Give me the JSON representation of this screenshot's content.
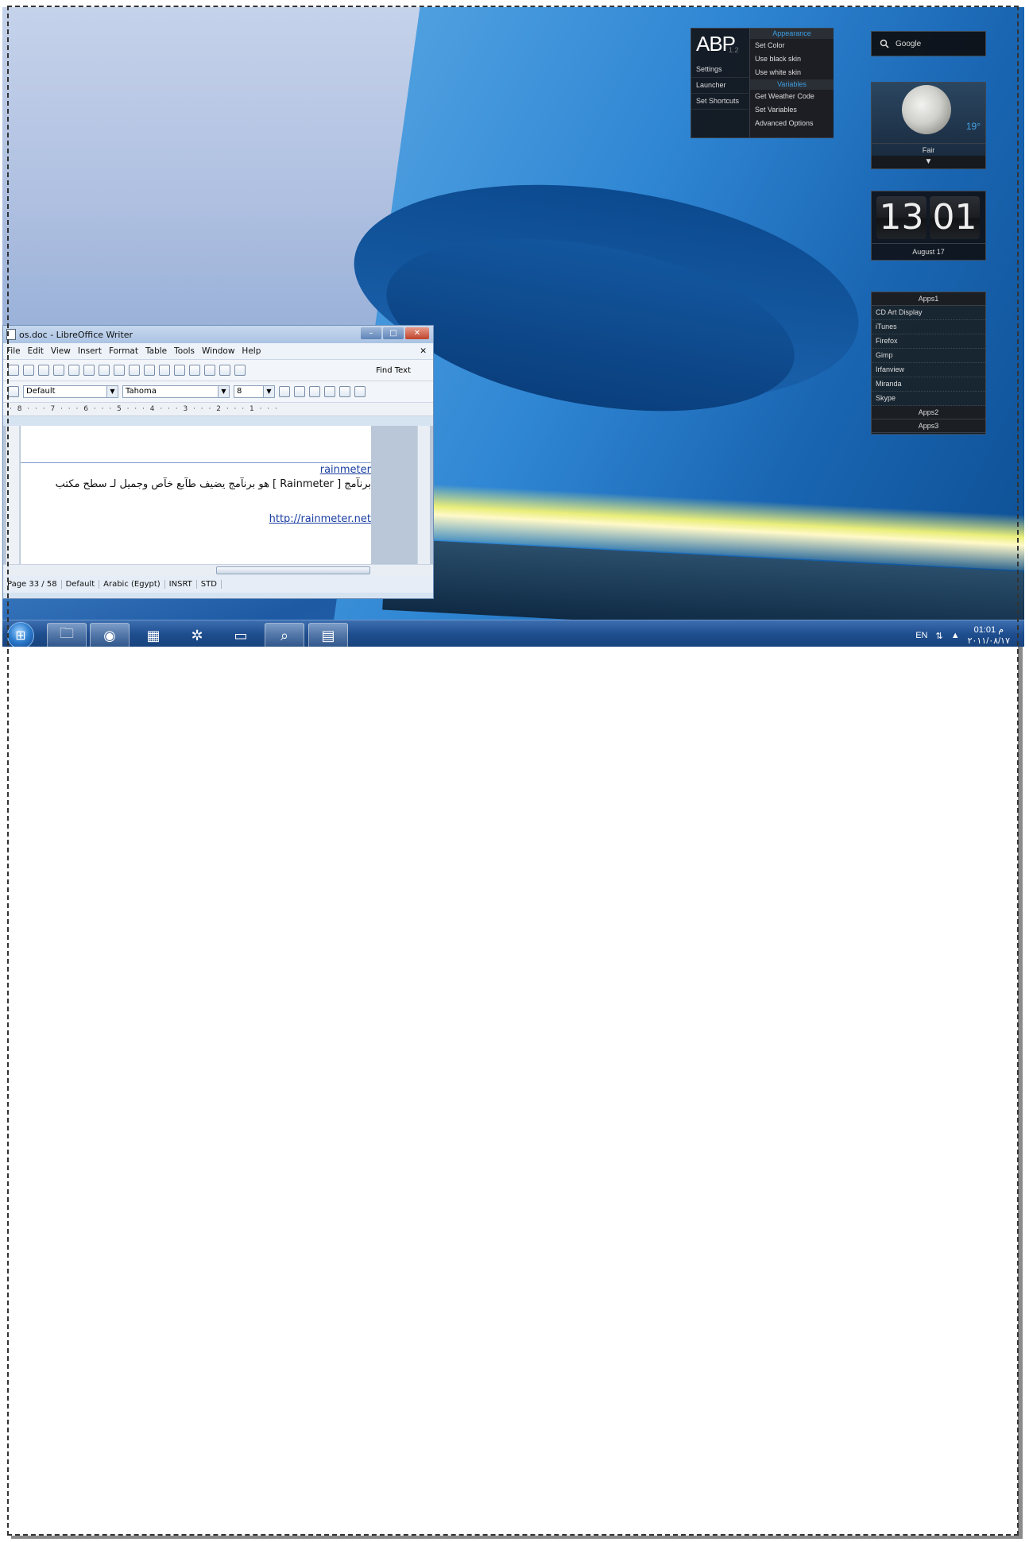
{
  "writer": {
    "title": "os.doc - LibreOffice Writer",
    "menu": [
      "File",
      "Edit",
      "View",
      "Insert",
      "Format",
      "Table",
      "Tools",
      "Window",
      "Help"
    ],
    "find_text": "Find Text",
    "style_value": "Default",
    "font_value": "Tahoma",
    "size_value": "8",
    "ruler_text": "· 8 · · · 7 · · · 6 · · · 5 · · · 4 · · · 3 · · · 2 · · · 1 · · ·",
    "doc_heading": "rainmeter",
    "doc_paragraph": "برنآمج [ Rainmeter ] هو برنآمج يضيف طآبع خآص وجميل لـ سطح مكتب",
    "doc_link": "http://rainmeter.net",
    "status": {
      "page": "Page 33 / 58",
      "style": "Default",
      "language": "Arabic (Egypt)",
      "mode": "INSRT",
      "selection": "STD"
    }
  },
  "abp": {
    "logo": "ABP",
    "version": "1.2",
    "left_items": [
      "Settings",
      "Launcher",
      "Set Shortcuts"
    ],
    "appearance_header": "Appearance",
    "appearance_items": [
      "Set Color",
      "Use black skin",
      "Use white skin"
    ],
    "variables_header": "Variables",
    "variables_items": [
      "Get Weather Code",
      "Set Variables",
      "Advanced Options"
    ]
  },
  "search": {
    "placeholder": "Google"
  },
  "weather": {
    "temp": "19°",
    "condition": "Fair"
  },
  "clock_widget": {
    "hour": "13",
    "minute": "01",
    "date": "August 17"
  },
  "apps": {
    "header1": "Apps1",
    "items": [
      "CD Art Display",
      "iTunes",
      "Firefox",
      "Gimp",
      "Irfanview",
      "Miranda",
      "Skype"
    ],
    "header2": "Apps2",
    "header3": "Apps3"
  },
  "taskbar": {
    "lang": "EN",
    "time": "01:01 م",
    "date": "٢٠١١/٠٨/١٧"
  },
  "colors": {
    "accent": "#3c9de0",
    "taskbar": "#1f4e8f"
  }
}
